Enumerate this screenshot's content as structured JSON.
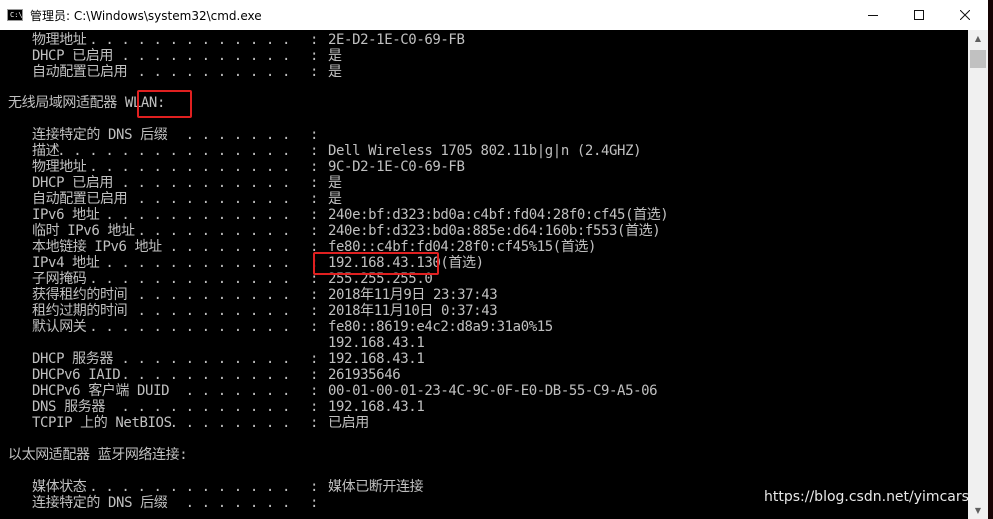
{
  "window": {
    "title": "管理员: C:\\Windows\\system32\\cmd.exe",
    "icon_text": "C:\\"
  },
  "console": {
    "lines": [
      {
        "label": "物理地址",
        "dots": ". . . . . . . . . . . . .",
        "value": "2E-D2-1E-C0-69-FB"
      },
      {
        "label": "DHCP 已启用",
        "dots": ". . . . . . . . . . .",
        "value": "是"
      },
      {
        "label": "自动配置已启用",
        "dots": ". . . . . . . . . .",
        "value": "是"
      },
      {
        "header": "无线局域网适配器 WLAN:"
      },
      {
        "label": "连接特定的 DNS 后缀",
        "dots": ". . . . . . .",
        "value": ""
      },
      {
        "label": "描述",
        "dots": ". . . . . . . . . . . . . . .",
        "value": "Dell Wireless 1705 802.11b|g|n (2.4GHZ)"
      },
      {
        "label": "物理地址",
        "dots": ". . . . . . . . . . . . .",
        "value": "9C-D2-1E-C0-69-FB"
      },
      {
        "label": "DHCP 已启用",
        "dots": ". . . . . . . . . . .",
        "value": "是"
      },
      {
        "label": "自动配置已启用",
        "dots": ". . . . . . . . . .",
        "value": "是"
      },
      {
        "label": "IPv6 地址",
        "dots": ". . . . . . . . . . . .",
        "value": "240e:bf:d323:bd0a:c4bf:fd04:28f0:cf45(首选)"
      },
      {
        "label": "临时 IPv6 地址",
        "dots": ". . . . . . . . . .",
        "value": "240e:bf:d323:bd0a:885e:d64:160b:f553(首选)"
      },
      {
        "label": "本地链接 IPv6 地址",
        "dots": ". . . . . . . .",
        "value": "fe80::c4bf:fd04:28f0:cf45%15(首选)"
      },
      {
        "label": "IPv4 地址",
        "dots": ". . . . . . . . . . . .",
        "value": "192.168.43.130(首选)"
      },
      {
        "label": "子网掩码",
        "dots": ". . . . . . . . . . . . .",
        "value": "255.255.255.0"
      },
      {
        "label": "获得租约的时间",
        "dots": ". . . . . . . . . .",
        "value": "2018年11月9日 23:37:43"
      },
      {
        "label": "租约过期的时间",
        "dots": ". . . . . . . . . .",
        "value": "2018年11月10日 0:37:43"
      },
      {
        "label": "默认网关",
        "dots": ". . . . . . . . . . . . .",
        "value": "fe80::8619:e4c2:d8a9:31a0%15"
      },
      {
        "label": "",
        "dots": "",
        "value": "192.168.43.1",
        "nocolon": true
      },
      {
        "label": "DHCP 服务器",
        "dots": ". . . . . . . . . . .",
        "value": "192.168.43.1"
      },
      {
        "label": "DHCPv6 IAID",
        "dots": ". . . . . . . . . . .",
        "value": "261935646"
      },
      {
        "label": "DHCPv6 客户端 DUID",
        "dots": ". . . . . . .",
        "value": "00-01-00-01-23-4C-9C-0F-E0-DB-55-C9-A5-06"
      },
      {
        "label": "DNS 服务器",
        "dots": ". . . . . . . . . . .",
        "value": "192.168.43.1"
      },
      {
        "label": "TCPIP 上的 NetBIOS",
        "dots": ". . . . . . . .",
        "value": "已启用"
      },
      {
        "header": "以太网适配器 蓝牙网络连接:"
      },
      {
        "label": "媒体状态",
        "dots": ". . . . . . . . . . . . .",
        "value": "媒体已断开连接"
      },
      {
        "label": "连接特定的 DNS 后缀",
        "dots": ". . . . . . .",
        "value": ""
      }
    ]
  },
  "watermark": "https://blog.csdn.net/yimcars",
  "colors": {
    "highlight": "#e02020",
    "console_text": "#c0c0c0",
    "console_bg": "#000000"
  }
}
